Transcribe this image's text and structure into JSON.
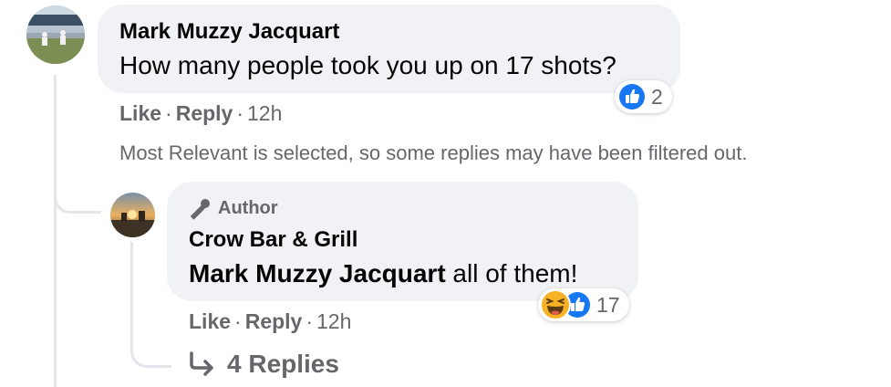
{
  "comment": {
    "author": "Mark Muzzy Jacquart",
    "text": "How many people took you up on 17 shots?",
    "reaction_count": "2",
    "reaction_icons": [
      "like-icon"
    ],
    "actions": {
      "like": "Like",
      "reply": "Reply",
      "time": "12h"
    }
  },
  "filter_notice": "Most Relevant is selected, so some replies may have been filtered out.",
  "reply": {
    "badge": "Author",
    "author": "Crow Bar & Grill",
    "mention": "Mark Muzzy Jacquart",
    "text": " all of them!",
    "reaction_count": "17",
    "reaction_icons": [
      "haha-icon",
      "like-icon"
    ],
    "actions": {
      "like": "Like",
      "reply": "Reply",
      "time": "12h"
    },
    "more_replies": "4 Replies"
  },
  "colors": {
    "secondary_text": "#65676b",
    "bubble": "#f0f2f5",
    "like_blue": "#1877f2",
    "haha_yellow": "#f7b125"
  }
}
